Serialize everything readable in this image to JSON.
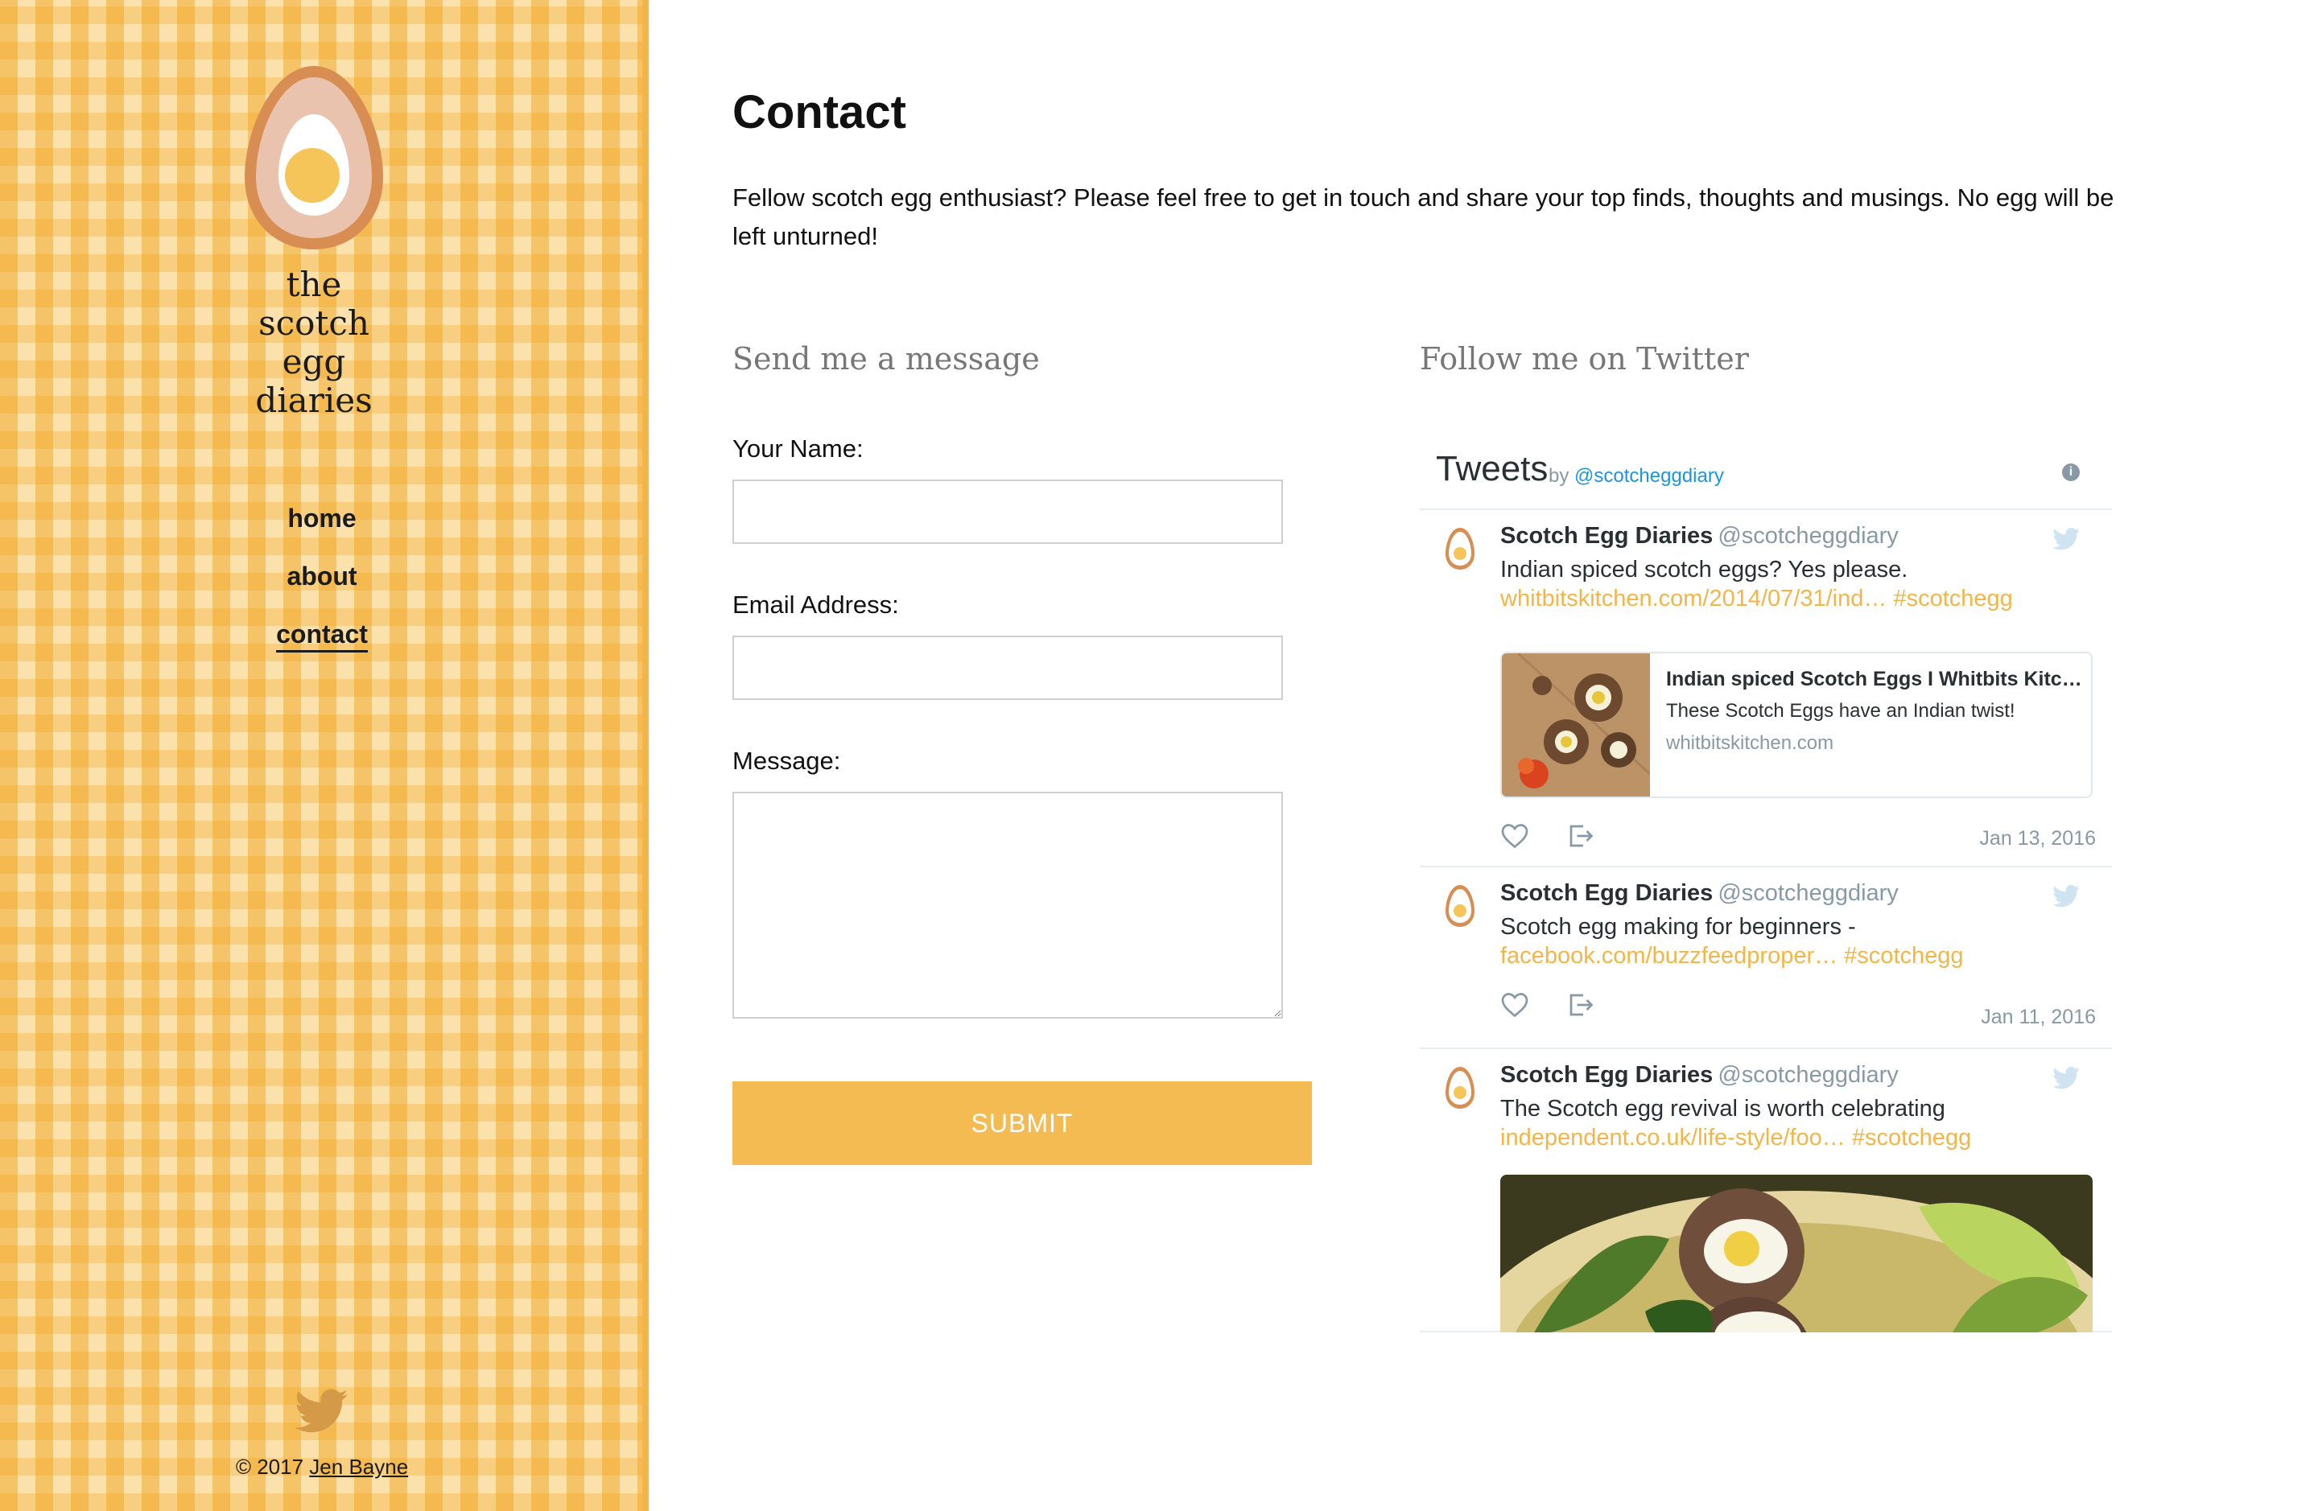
{
  "brand": {
    "lines": [
      "the",
      "scotch",
      "egg",
      "diaries"
    ]
  },
  "nav": [
    {
      "label": "home",
      "active": false
    },
    {
      "label": "about",
      "active": false
    },
    {
      "label": "contact",
      "active": true
    }
  ],
  "footer": {
    "copyright": "© 2017",
    "author": "Jen Bayne",
    "twitter_icon": "twitter-bird-icon"
  },
  "page": {
    "title": "Contact",
    "intro": "Fellow scotch egg enthusiast? Please feel free to get in touch and share your top finds, thoughts and musings. No egg will be left unturned!"
  },
  "form": {
    "heading": "Send me a message",
    "name_label": "Your Name:",
    "name_value": "",
    "email_label": "Email Address:",
    "email_value": "",
    "message_label": "Message:",
    "message_value": "",
    "submit_label": "SUBMIT"
  },
  "twitter": {
    "heading": "Follow me on Twitter",
    "widget_title": "Tweets",
    "by": "by",
    "handle": "@scotcheggdiary",
    "info_icon": "info-icon",
    "tweets": [
      {
        "name": "Scotch Egg Diaries",
        "handle": "@scotcheggdiary",
        "text": "Indian spiced scotch eggs? Yes please.",
        "link": "whitbitskitchen.com/2014/07/31/ind… #scotchegg",
        "card": {
          "title": "Indian spiced Scotch Eggs I Whitbits Kitc…",
          "description": "These Scotch Eggs have an Indian twist!",
          "domain": "whitbitskitchen.com"
        },
        "date": "Jan 13, 2016"
      },
      {
        "name": "Scotch Egg Diaries",
        "handle": "@scotcheggdiary",
        "text": "Scotch egg making for beginners -",
        "link": "facebook.com/buzzfeedproper… #scotchegg",
        "date": "Jan 11, 2016"
      },
      {
        "name": "Scotch Egg Diaries",
        "handle": "@scotcheggdiary",
        "text": "The Scotch egg revival is worth celebrating",
        "link": "independent.co.uk/life-style/foo… #scotchegg"
      }
    ]
  },
  "colors": {
    "accent": "#f4bb52",
    "link": "#f4b548",
    "twitter_blue": "#1b95e0",
    "muted": "#8899a6"
  }
}
